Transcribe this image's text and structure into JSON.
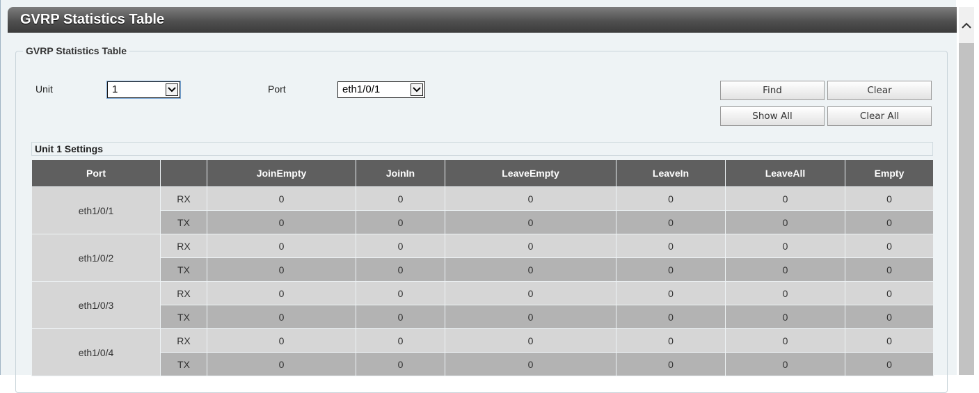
{
  "header": {
    "title": "GVRP Statistics Table"
  },
  "form": {
    "legend": "GVRP Statistics Table",
    "unit_label": "Unit",
    "unit_value": "1",
    "port_label": "Port",
    "port_value": "eth1/0/1"
  },
  "buttons": {
    "find": "Find",
    "clear": "Clear",
    "show_all": "Show All",
    "clear_all": "Clear All"
  },
  "settings": {
    "title": "Unit 1 Settings"
  },
  "table": {
    "headers": [
      "Port",
      "",
      "JoinEmpty",
      "JoinIn",
      "LeaveEmpty",
      "LeaveIn",
      "LeaveAll",
      "Empty"
    ],
    "rows": [
      {
        "port": "eth1/0/1",
        "rx": {
          "dir": "RX",
          "vals": [
            "0",
            "0",
            "0",
            "0",
            "0",
            "0"
          ]
        },
        "tx": {
          "dir": "TX",
          "vals": [
            "0",
            "0",
            "0",
            "0",
            "0",
            "0"
          ]
        }
      },
      {
        "port": "eth1/0/2",
        "rx": {
          "dir": "RX",
          "vals": [
            "0",
            "0",
            "0",
            "0",
            "0",
            "0"
          ]
        },
        "tx": {
          "dir": "TX",
          "vals": [
            "0",
            "0",
            "0",
            "0",
            "0",
            "0"
          ]
        }
      },
      {
        "port": "eth1/0/3",
        "rx": {
          "dir": "RX",
          "vals": [
            "0",
            "0",
            "0",
            "0",
            "0",
            "0"
          ]
        },
        "tx": {
          "dir": "TX",
          "vals": [
            "0",
            "0",
            "0",
            "0",
            "0",
            "0"
          ]
        }
      },
      {
        "port": "eth1/0/4",
        "rx": {
          "dir": "RX",
          "vals": [
            "0",
            "0",
            "0",
            "0",
            "0",
            "0"
          ]
        },
        "tx": {
          "dir": "TX",
          "vals": [
            "0",
            "0",
            "0",
            "0",
            "0",
            "0"
          ]
        }
      }
    ]
  },
  "icons": {
    "select_arrow": "chevron-down-icon",
    "scroll_up": "chevron-up-icon"
  },
  "colors": {
    "header_bg": "#5f5f5f",
    "rx_row": "#d6d6d6",
    "tx_row": "#b3b3b3",
    "panel_bg": "#eef3f5"
  }
}
